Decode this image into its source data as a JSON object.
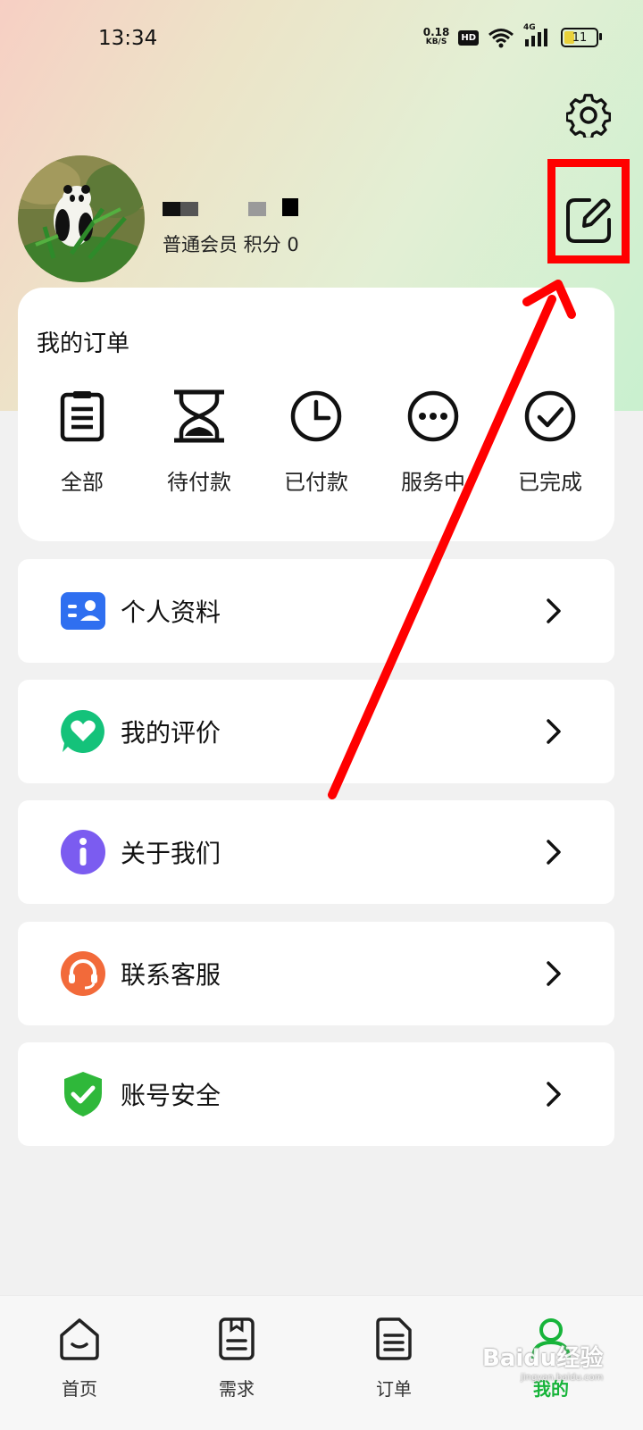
{
  "status_bar": {
    "time": "13:34",
    "net_speed_value": "0.18",
    "net_speed_unit": "KB/S",
    "hd_label": "HD",
    "network_label": "4G",
    "battery_level": "11"
  },
  "profile": {
    "member_text": "普通会员 积分 0"
  },
  "orders": {
    "title": "我的订单",
    "items": [
      {
        "label": "全部",
        "icon": "clipboard-icon"
      },
      {
        "label": "待付款",
        "icon": "hourglass-icon"
      },
      {
        "label": "已付款",
        "icon": "clock-icon"
      },
      {
        "label": "服务中",
        "icon": "more-dots-icon"
      },
      {
        "label": "已完成",
        "icon": "check-circle-icon"
      }
    ]
  },
  "menu": {
    "items": [
      {
        "label": "个人资料",
        "icon": "id-card-icon",
        "color": "#2f6ff0"
      },
      {
        "label": "我的评价",
        "icon": "heart-chat-icon",
        "color": "#14c27a"
      },
      {
        "label": "关于我们",
        "icon": "info-icon",
        "color": "#7b5cf0"
      },
      {
        "label": "联系客服",
        "icon": "headset-icon",
        "color": "#f26a3a"
      },
      {
        "label": "账号安全",
        "icon": "shield-check-icon",
        "color": "#2fb83a"
      }
    ]
  },
  "tabbar": {
    "items": [
      {
        "label": "首页",
        "icon": "home-icon"
      },
      {
        "label": "需求",
        "icon": "document-icon"
      },
      {
        "label": "订单",
        "icon": "list-icon"
      },
      {
        "label": "我的",
        "icon": "user-icon",
        "active": true
      }
    ]
  },
  "colors": {
    "annotation_red": "#ff0000",
    "active_green": "#17b43a"
  },
  "watermark": {
    "text": "Baidu经验",
    "url_text": "jingyan.baidu.com"
  }
}
